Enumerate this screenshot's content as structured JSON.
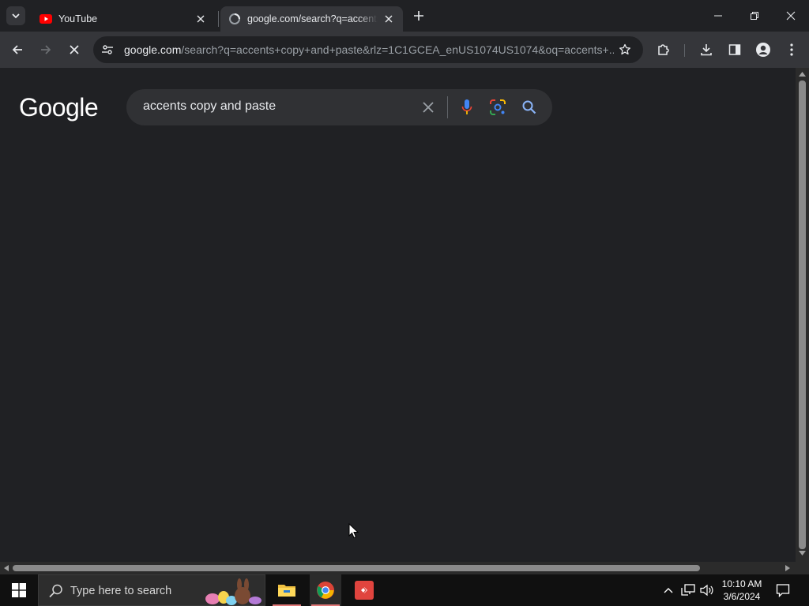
{
  "tabs": [
    {
      "title": "YouTube",
      "favicon": "youtube-icon",
      "active": false
    },
    {
      "title": "google.com/search?q=accents+copy+and+paste",
      "favicon": "loading-icon",
      "active": true
    }
  ],
  "address_bar": {
    "host": "google.com",
    "path": "/search?q=accents+copy+and+paste&rlz=1C1GCEA_enUS1074US1074&oq=accents+..."
  },
  "page": {
    "logo_text": "Google",
    "search_query": "accents copy and paste"
  },
  "taskbar": {
    "search_placeholder": "Type here to search",
    "time": "10:10 AM",
    "date": "3/6/2024"
  },
  "colors": {
    "chrome_bg": "#202124",
    "toolbar_bg": "#35363a",
    "search_box": "#303134",
    "mic_blue": "#4285f4",
    "search_icon": "#8ab4f8"
  }
}
